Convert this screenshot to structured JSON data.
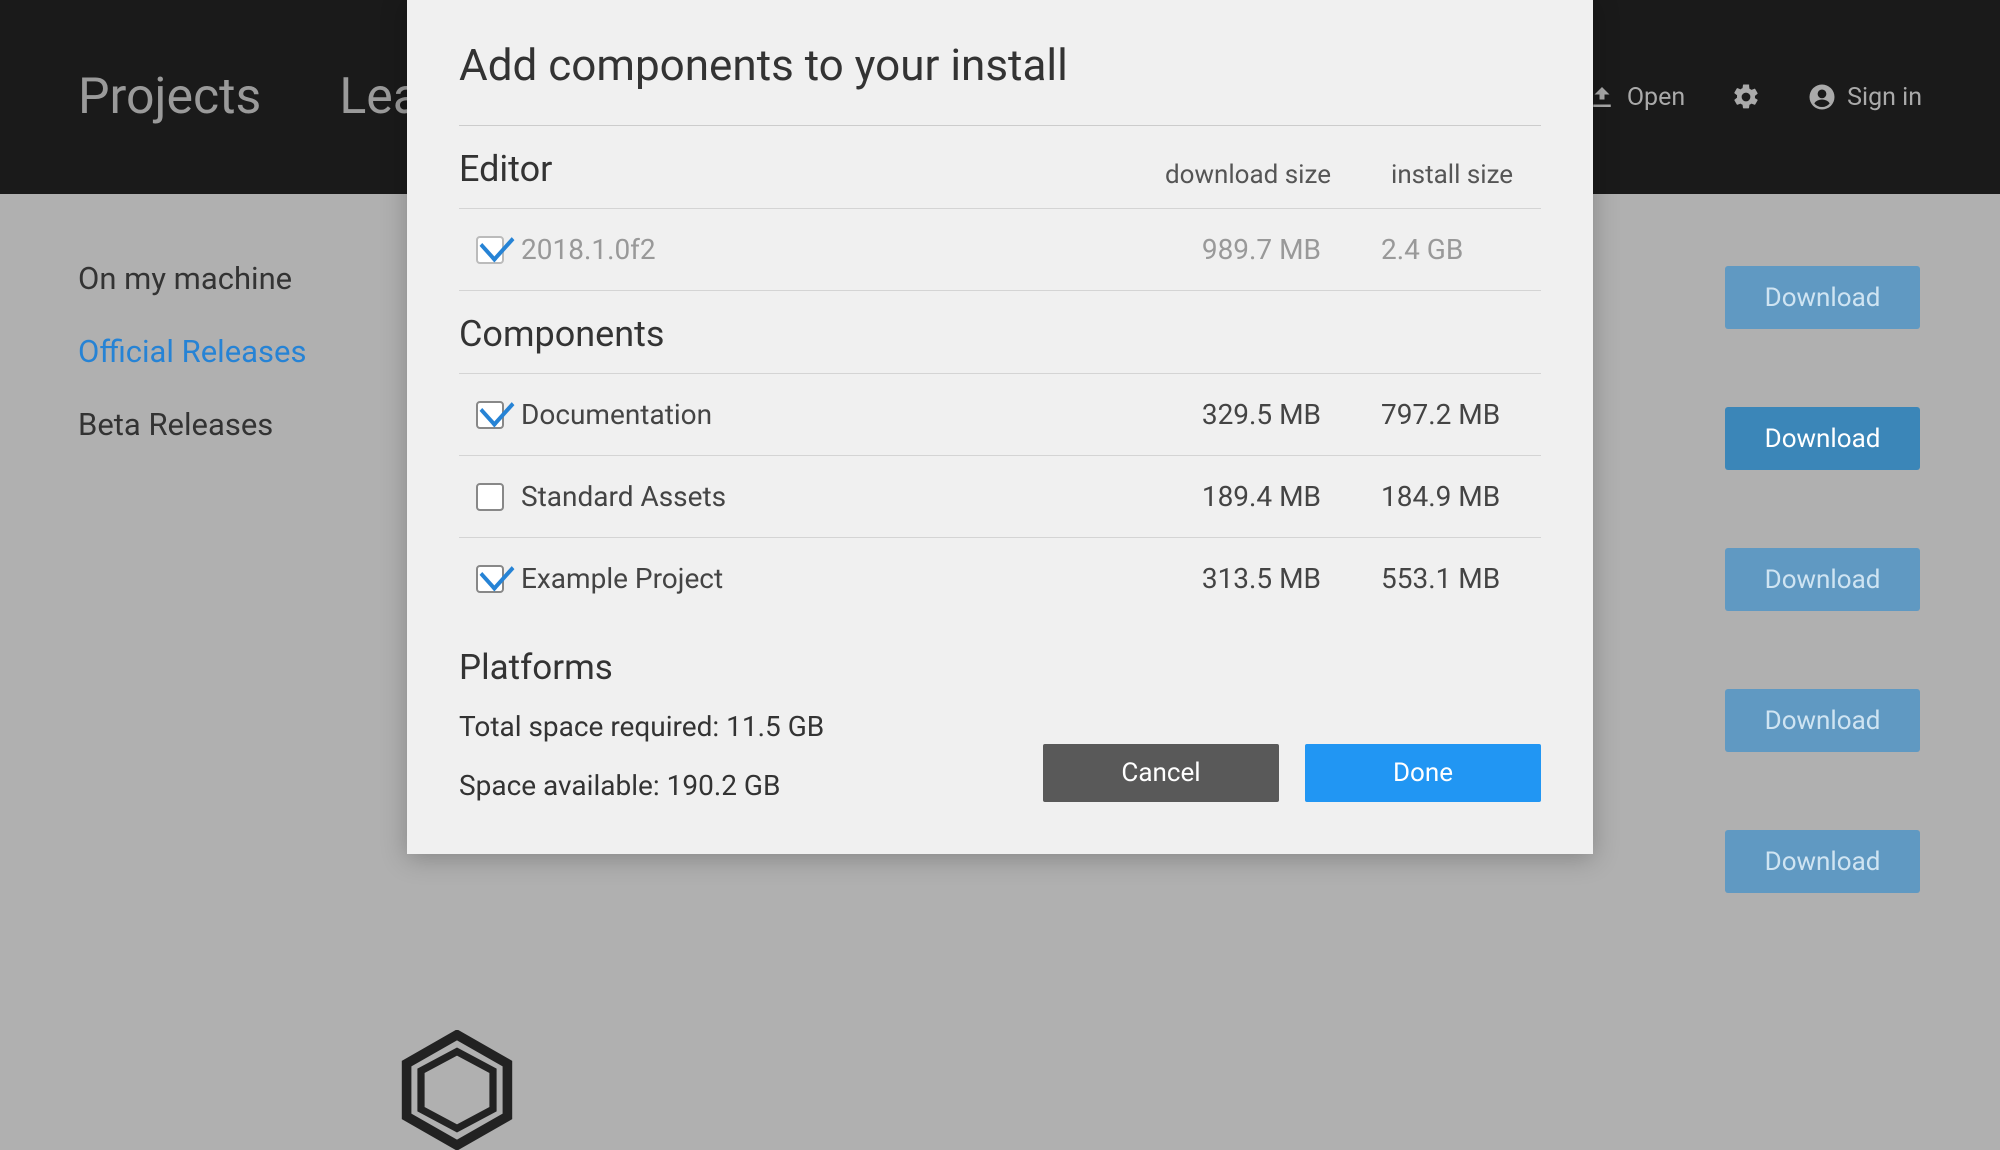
{
  "topbar": {
    "tabs": [
      "Projects",
      "Learn"
    ],
    "open_label": "Open",
    "signin_label": "Sign in"
  },
  "sidebar": {
    "items": [
      {
        "label": "On my machine",
        "active": false
      },
      {
        "label": "Official Releases",
        "active": true
      },
      {
        "label": "Beta Releases",
        "active": false
      }
    ]
  },
  "downloads": {
    "button_label": "Download",
    "count": 5
  },
  "modal": {
    "title": "Add components to your install",
    "editor_section": "Editor",
    "components_section": "Components",
    "platforms_section": "Platforms",
    "col_download": "download size",
    "col_install": "install size",
    "editor": {
      "name": "2018.1.0f2",
      "download_size": "989.7 MB",
      "install_size": "2.4 GB",
      "checked": true,
      "disabled": true
    },
    "components": [
      {
        "name": "Documentation",
        "download_size": "329.5 MB",
        "install_size": "797.2 MB",
        "checked": true
      },
      {
        "name": "Standard Assets",
        "download_size": "189.4 MB",
        "install_size": "184.9 MB",
        "checked": false
      },
      {
        "name": "Example Project",
        "download_size": "313.5 MB",
        "install_size": "553.1 MB",
        "checked": true
      }
    ],
    "total_required_label": "Total space required:",
    "total_required_value": "11.5 GB",
    "available_label": "Space available:",
    "available_value": "190.2 GB",
    "cancel_label": "Cancel",
    "done_label": "Done"
  }
}
